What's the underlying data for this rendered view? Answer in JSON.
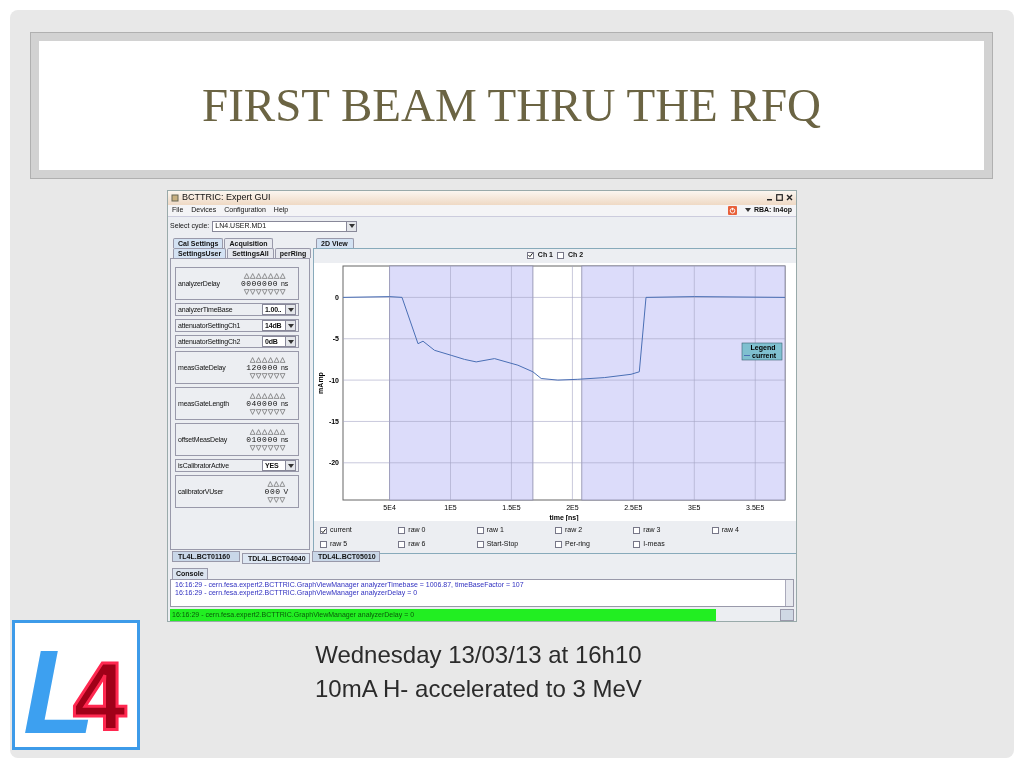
{
  "slide": {
    "title": "FIRST BEAM THRU THE RFQ",
    "caption": [
      "Wednesday 13/03/13 at 16h10",
      "10mA H- accelerated to 3 MeV"
    ],
    "logo": [
      "L",
      "4"
    ]
  },
  "window": {
    "title": "BCTTRIC: Expert GUI",
    "menu": [
      "File",
      "Devices",
      "Configuration",
      "Help"
    ],
    "user": "RBA: In4op",
    "cycle": {
      "label": "Select cycle:",
      "value": "LN4.USER.MD1"
    }
  },
  "left_tabs": [
    [
      {
        "label": "Cal Settings",
        "selected": true
      },
      {
        "label": "Acquisition",
        "selected": false
      }
    ],
    [
      {
        "label": "SettingsUser",
        "selected": true
      },
      {
        "label": "SettingsAll",
        "selected": false
      },
      {
        "label": "perRing",
        "selected": false
      }
    ]
  ],
  "params": [
    {
      "kind": "spinner",
      "label": "analyzerDelay",
      "value": "0000000",
      "unit": "ns"
    },
    {
      "kind": "dropdown",
      "label": "analyzerTimeBase",
      "value": "1.00.."
    },
    {
      "kind": "dropdown",
      "label": "attenuatorSettingCh1",
      "value": "14dB"
    },
    {
      "kind": "dropdown",
      "label": "attenuatorSettingCh2",
      "value": "0dB"
    },
    {
      "kind": "spinner",
      "label": "measGateDelay",
      "value": "120000",
      "unit": "ns"
    },
    {
      "kind": "spinner",
      "label": "measGateLength",
      "value": "040000",
      "unit": "ns"
    },
    {
      "kind": "spinner",
      "label": "offsetMeasDelay",
      "value": "010000",
      "unit": "ns"
    },
    {
      "kind": "dropdown",
      "label": "isCalibratorActive",
      "value": "YES"
    },
    {
      "kind": "spinner",
      "label": "calibratorVUser",
      "value": "000",
      "unit": "V"
    }
  ],
  "view_tab": {
    "label": "2D View",
    "selected": true
  },
  "channels": [
    {
      "label": "Ch 1",
      "checked": true
    },
    {
      "label": "Ch 2",
      "checked": false
    }
  ],
  "chart_data": {
    "type": "line",
    "xlabel": "time [ns]",
    "ylabel": "mAmp",
    "x": [
      11800,
      50000,
      60200,
      73300,
      77400,
      86900,
      100600,
      111500,
      121100,
      136100,
      155300,
      167600,
      174400,
      188000,
      204400,
      226200,
      248100,
      254900,
      260400,
      300000,
      374400
    ],
    "series": [
      {
        "name": "current",
        "color": "#4a6fb5",
        "values": [
          0,
          0.1,
          0,
          -5.6,
          -5.3,
          -6.4,
          -7.0,
          -7.5,
          -7.8,
          -7.4,
          -8.2,
          -9.0,
          -9.8,
          -10,
          -9.9,
          -9.7,
          -9.3,
          -9.0,
          0,
          0.1,
          0
        ]
      }
    ],
    "xlim": [
      11800,
      374400
    ],
    "ylim": [
      -24.5,
      3.8
    ],
    "xticks": [
      {
        "value": 50000,
        "label": "5E4"
      },
      {
        "value": 100000,
        "label": "1E5"
      },
      {
        "value": 150000,
        "label": "1.5E5"
      },
      {
        "value": 200000,
        "label": "2E5"
      },
      {
        "value": 250000,
        "label": "2.5E5"
      },
      {
        "value": 300000,
        "label": "3E5"
      },
      {
        "value": 350000,
        "label": "3.5E5"
      }
    ],
    "yticks": [
      0,
      -5,
      -10,
      -15,
      -20
    ],
    "grid": true,
    "bands": [
      {
        "axis": "x",
        "from": 50000,
        "to": 167600
      },
      {
        "axis": "x",
        "from": 207700,
        "to": 374400
      }
    ]
  },
  "legend_title": "Legend",
  "signals": [
    {
      "label": "current",
      "checked": true
    },
    {
      "label": "raw 0",
      "checked": false
    },
    {
      "label": "raw 1",
      "checked": false
    },
    {
      "label": "raw 2",
      "checked": false
    },
    {
      "label": "raw 3",
      "checked": false
    },
    {
      "label": "raw 4",
      "checked": false
    },
    {
      "label": "raw 5",
      "checked": false
    },
    {
      "label": "raw 6",
      "checked": false
    },
    {
      "label": "Start-Stop",
      "checked": false
    },
    {
      "label": "Per-ring",
      "checked": false
    },
    {
      "label": "I-meas",
      "checked": false
    }
  ],
  "device_tabs": [
    {
      "label": "TL4L.BCT01160",
      "selected": false
    },
    {
      "label": "TDL4L.BCT04040",
      "selected": true
    },
    {
      "label": "TDL4L.BCT05010",
      "selected": false
    }
  ],
  "console": {
    "tab": "Console",
    "lines": [
      "16:16:29 - cern.fesa.expert2.BCTTRIC.GraphViewManager analyzerTimebase = 1006.87, timeBaseFactor = 107",
      "16:16:29 - cern.fesa.expert2.BCTTRIC.GraphViewManager analyzerDelay = 0"
    ],
    "status": "16:16:29 - cern.fesa.expert2.BCTTRIC.GraphViewManager analyzerDelay = 0"
  }
}
